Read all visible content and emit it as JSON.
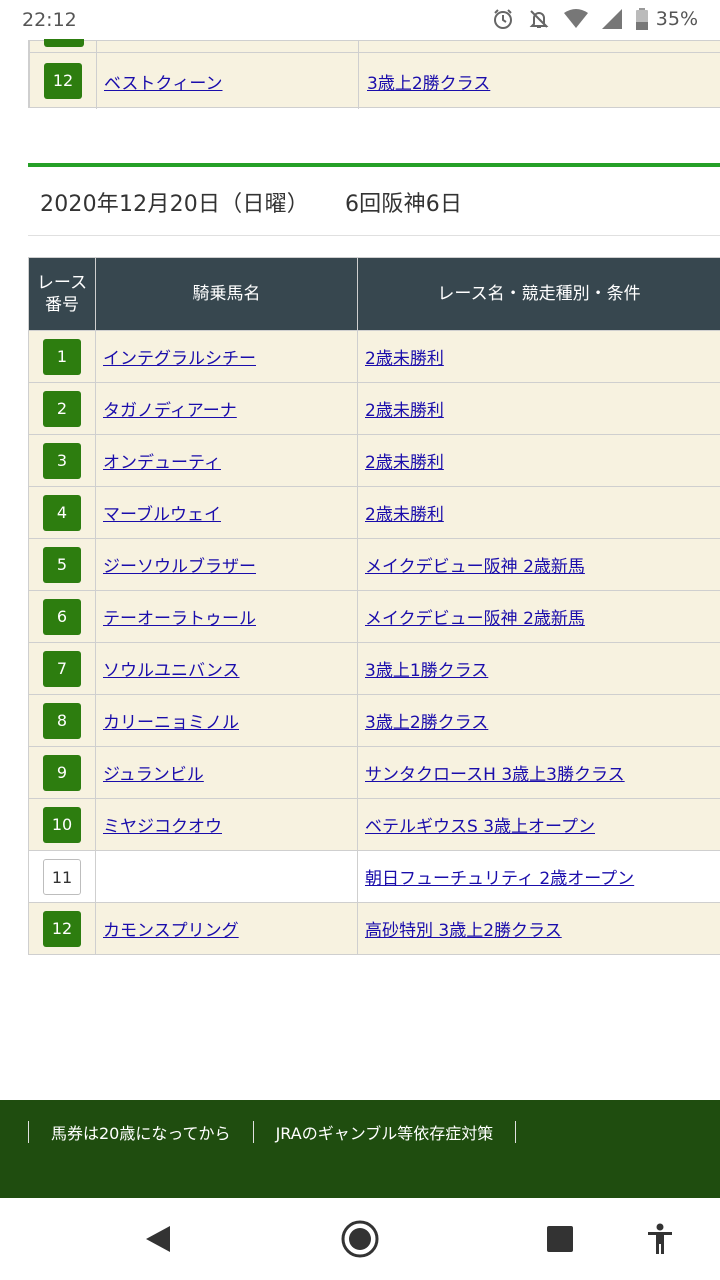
{
  "status_bar": {
    "time": "22:12",
    "battery": "35%",
    "icons": [
      "alarm-icon",
      "notifications-off-icon",
      "wifi-icon",
      "signal-icon",
      "battery-icon"
    ]
  },
  "previous_table": {
    "last_row": {
      "num": "12",
      "horse": "ベストクィーン",
      "race": "3歳上2勝クラス"
    }
  },
  "section": {
    "date": "2020年12月20日（日曜）",
    "venue": "6回阪神6日"
  },
  "table": {
    "headers": {
      "num": "レース\n番号",
      "horse": "騎乗馬名",
      "race": "レース名・競走種別・条件"
    },
    "rows": [
      {
        "num": "1",
        "horse": "インテグラルシチー",
        "race": "2歳未勝利"
      },
      {
        "num": "2",
        "horse": "タガノディアーナ",
        "race": "2歳未勝利"
      },
      {
        "num": "3",
        "horse": "オンデューティ",
        "race": "2歳未勝利"
      },
      {
        "num": "4",
        "horse": "マーブルウェイ",
        "race": "2歳未勝利"
      },
      {
        "num": "5",
        "horse": "ジーソウルブラザー",
        "race": "メイクデビュー阪神 2歳新馬"
      },
      {
        "num": "6",
        "horse": "テーオーラトゥール",
        "race": "メイクデビュー阪神 2歳新馬"
      },
      {
        "num": "7",
        "horse": "ソウルユニバンス",
        "race": "3歳上1勝クラス"
      },
      {
        "num": "8",
        "horse": "カリーニョミノル",
        "race": "3歳上2勝クラス"
      },
      {
        "num": "9",
        "horse": "ジュランビル",
        "race": "サンタクロースH 3歳上3勝クラス"
      },
      {
        "num": "10",
        "horse": "ミヤジコクオウ",
        "race": "ベテルギウスS 3歳上オープン"
      },
      {
        "num": "11",
        "horse": "",
        "race": "朝日フューチュリティ 2歳オープン"
      },
      {
        "num": "12",
        "horse": "カモンスプリング",
        "race": "高砂特別 3歳上2勝クラス"
      }
    ]
  },
  "footer": {
    "links": [
      "馬券は20歳になってから",
      "JRAのギャンブル等依存症対策"
    ]
  },
  "nav": [
    "back-icon",
    "home-icon",
    "recents-icon",
    "accessibility-icon"
  ],
  "colors": {
    "badge_green": "#2d7d0f",
    "header_dark": "#37474f",
    "row_cream": "#f7f2e0",
    "footer_green": "#1f4d0f",
    "rule_green": "#25a027",
    "link_blue": "#1a0dab"
  }
}
